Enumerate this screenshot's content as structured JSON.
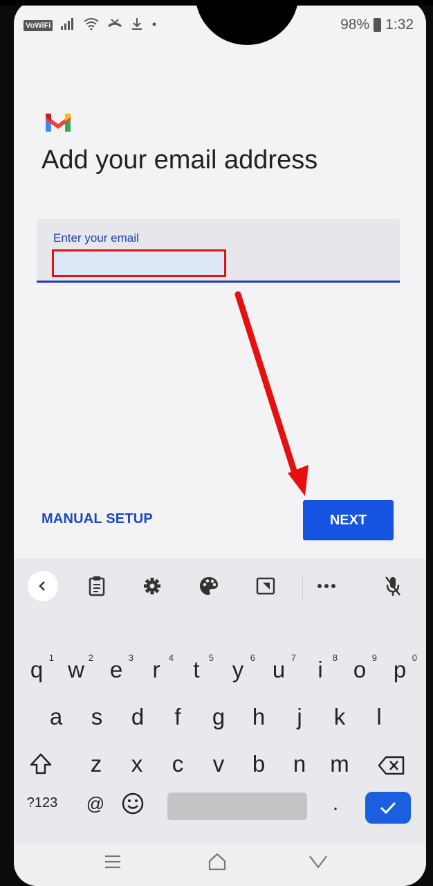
{
  "status_bar": {
    "vowifi": "VoWiFi",
    "battery_percent": "98%",
    "time": "1:32"
  },
  "header": {
    "title": "Add your email address"
  },
  "email_field": {
    "label": "Enter your email",
    "value": "",
    "placeholder": ""
  },
  "actions": {
    "manual_setup": "MANUAL SETUP",
    "next": "NEXT"
  },
  "keyboard": {
    "row1": [
      {
        "key": "q",
        "num": "1"
      },
      {
        "key": "w",
        "num": "2"
      },
      {
        "key": "e",
        "num": "3"
      },
      {
        "key": "r",
        "num": "4"
      },
      {
        "key": "t",
        "num": "5"
      },
      {
        "key": "y",
        "num": "6"
      },
      {
        "key": "u",
        "num": "7"
      },
      {
        "key": "i",
        "num": "8"
      },
      {
        "key": "o",
        "num": "9"
      },
      {
        "key": "p",
        "num": "0"
      }
    ],
    "row2": [
      "a",
      "s",
      "d",
      "f",
      "g",
      "h",
      "j",
      "k",
      "l"
    ],
    "row3": [
      "z",
      "x",
      "c",
      "v",
      "b",
      "n",
      "m"
    ],
    "symbols": "?123",
    "at": "@",
    "period": "."
  },
  "icons": {
    "toolbar": [
      "back-icon",
      "clipboard-icon",
      "settings-icon",
      "palette-icon",
      "resize-icon",
      "more-icon",
      "mic-off-icon"
    ],
    "nav": [
      "recent-apps-icon",
      "home-icon",
      "back-nav-icon"
    ]
  },
  "colors": {
    "accent": "#1553e0",
    "annotation": "#e61010",
    "field_underline": "#1a3bb8"
  }
}
